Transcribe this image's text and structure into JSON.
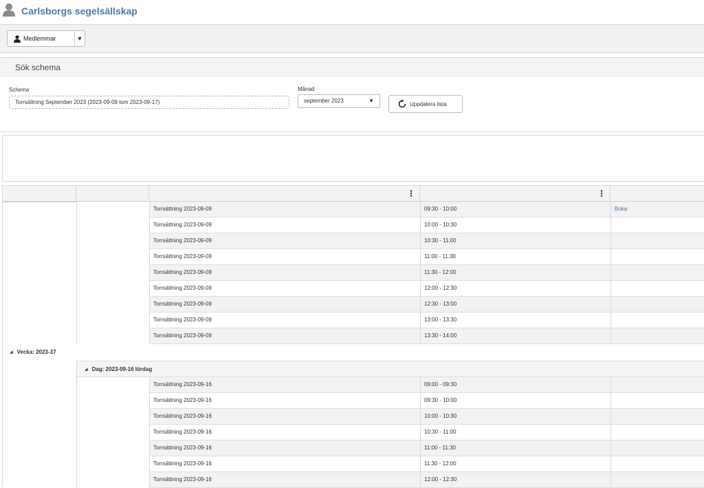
{
  "header": {
    "title": "Carlsborgs segelsällskap",
    "icon": "user-icon"
  },
  "toolbar": {
    "members_label": "Medlemmar",
    "caret": "▼"
  },
  "search": {
    "heading": "Sök schema",
    "schema_label": "Schema",
    "schema_value": "Torrsättning September 2023 (2023-09-09 tom 2023-09-17)",
    "month_label": "Månad",
    "month_value": "september 2023",
    "month_arrow": "▼",
    "update_label": "Uppdatera lista"
  },
  "grid": {
    "header_menu": "⋮",
    "group1_rows": [
      {
        "name": "Torrsättning 2023-09-09",
        "time": "09:30 - 10:00",
        "action": "Boka"
      },
      {
        "name": "Torrsättning 2023-09-09",
        "time": "10:00 - 10:30",
        "action": ""
      },
      {
        "name": "Torrsättning 2023-09-09",
        "time": "10:30 - 11:00",
        "action": ""
      },
      {
        "name": "Torrsättning 2023-09-09",
        "time": "11:00 - 11:30",
        "action": ""
      },
      {
        "name": "Torrsättning 2023-09-09",
        "time": "11:30 - 12:00",
        "action": ""
      },
      {
        "name": "Torrsättning 2023-09-09",
        "time": "12:00 - 12:30",
        "action": ""
      },
      {
        "name": "Torrsättning 2023-09-09",
        "time": "12:30 - 13:00",
        "action": ""
      },
      {
        "name": "Torrsättning 2023-09-09",
        "time": "13:00 - 13:30",
        "action": ""
      },
      {
        "name": "Torrsättning 2023-09-09",
        "time": "13:30 - 14:00",
        "action": ""
      }
    ],
    "week_label": "Vecka: 2023-37",
    "day_label": "Dag: 2023-09-16 lördag",
    "group2_rows": [
      {
        "name": "Torrsättning 2023-09-16",
        "time": "09:00 - 09:30",
        "action": ""
      },
      {
        "name": "Torrsättning 2023-09-16",
        "time": "09:30 - 10:00",
        "action": ""
      },
      {
        "name": "Torrsättning 2023-09-16",
        "time": "10:00 - 10:30",
        "action": ""
      },
      {
        "name": "Torrsättning 2023-09-16",
        "time": "10:30 - 11:00",
        "action": ""
      },
      {
        "name": "Torrsättning 2023-09-16",
        "time": "11:00 - 11:30",
        "action": ""
      },
      {
        "name": "Torrsättning 2023-09-16",
        "time": "11:30 - 12:00",
        "action": ""
      },
      {
        "name": "Torrsättning 2023-09-16",
        "time": "12:00 - 12:30",
        "action": ""
      }
    ]
  },
  "colors": {
    "accent": "#4a79a8",
    "row_alt": "#f2f2f2",
    "border": "#d8d8d8"
  }
}
